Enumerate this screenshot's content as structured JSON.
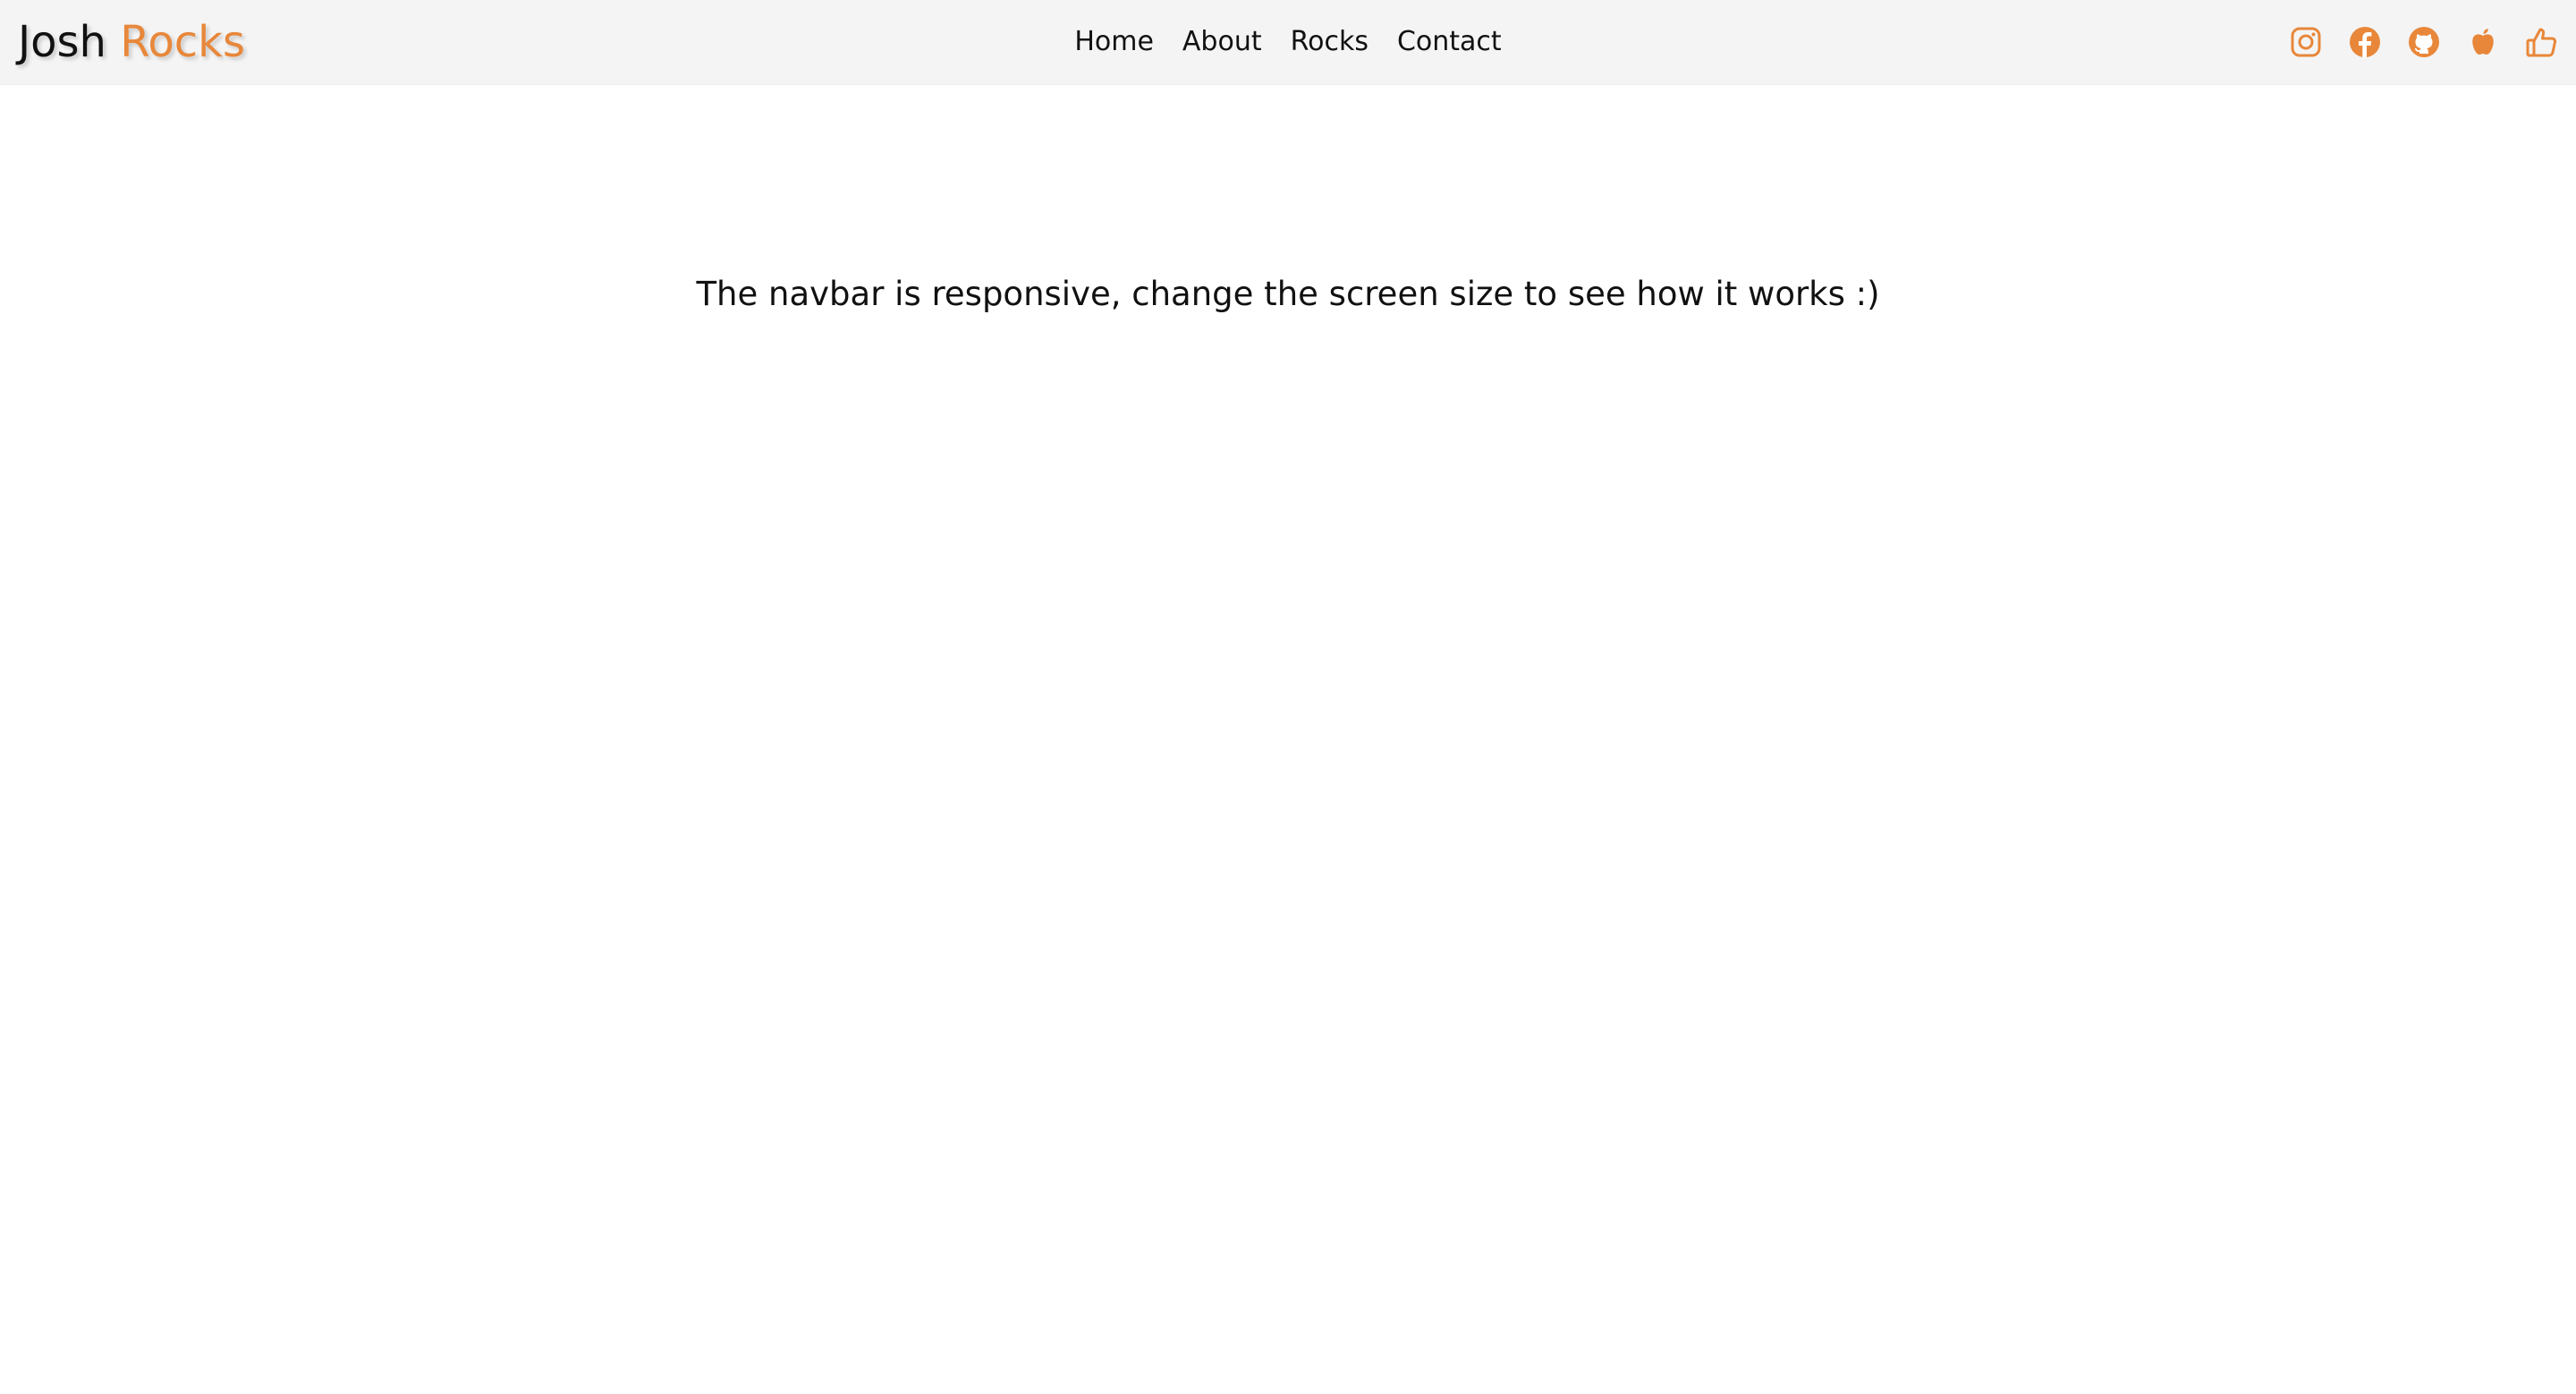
{
  "brand": {
    "first": "Josh",
    "second": "Rocks",
    "accent_color": "#e8873a"
  },
  "nav": {
    "links": [
      {
        "label": "Home"
      },
      {
        "label": "About"
      },
      {
        "label": "Rocks"
      },
      {
        "label": "Contact"
      }
    ]
  },
  "social": {
    "icons": [
      "instagram-icon",
      "facebook-icon",
      "github-icon",
      "apple-icon",
      "thumbs-up-icon"
    ]
  },
  "main": {
    "message": "The navbar is responsive, change the screen size to see how it works :)"
  }
}
